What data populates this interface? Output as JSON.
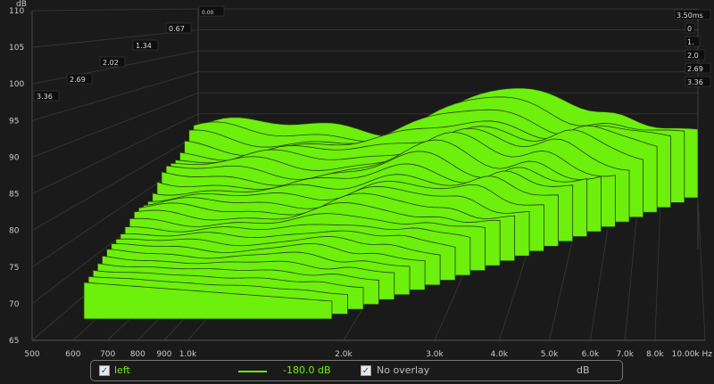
{
  "chart_data": {
    "type": "area",
    "ylabel": "dB",
    "y_ticks": [
      "110",
      "105",
      "100",
      "95",
      "90",
      "85",
      "80",
      "75",
      "70",
      "65"
    ],
    "ylim": [
      65,
      110
    ],
    "x_ticks": [
      "500",
      "600",
      "700",
      "800",
      "900",
      "1.0k",
      "2.0k",
      "3.0k",
      "4.0k",
      "5.0k",
      "6.0k",
      "7.0k",
      "8.0k",
      "10.00k Hz"
    ],
    "x_scale": "log",
    "depth_ticks_left": [
      "0.00",
      "0.67",
      "1.34",
      "2.02",
      "2.69",
      "3.36"
    ],
    "depth_ticks_right": [
      "3.50ms",
      "0",
      "1.",
      "2.0",
      "2.69",
      "3.36"
    ],
    "depth_unit": "ms",
    "fill_color": "#6cf00c",
    "series": [
      {
        "name": "left",
        "line_color": "#6cf00c"
      }
    ]
  },
  "legend": {
    "channel_label": "left",
    "channel_checked": "✓",
    "level_text": "-180.0 dB",
    "overlay_label": "No overlay",
    "overlay_checked": "✓",
    "unit_label": "dB"
  }
}
